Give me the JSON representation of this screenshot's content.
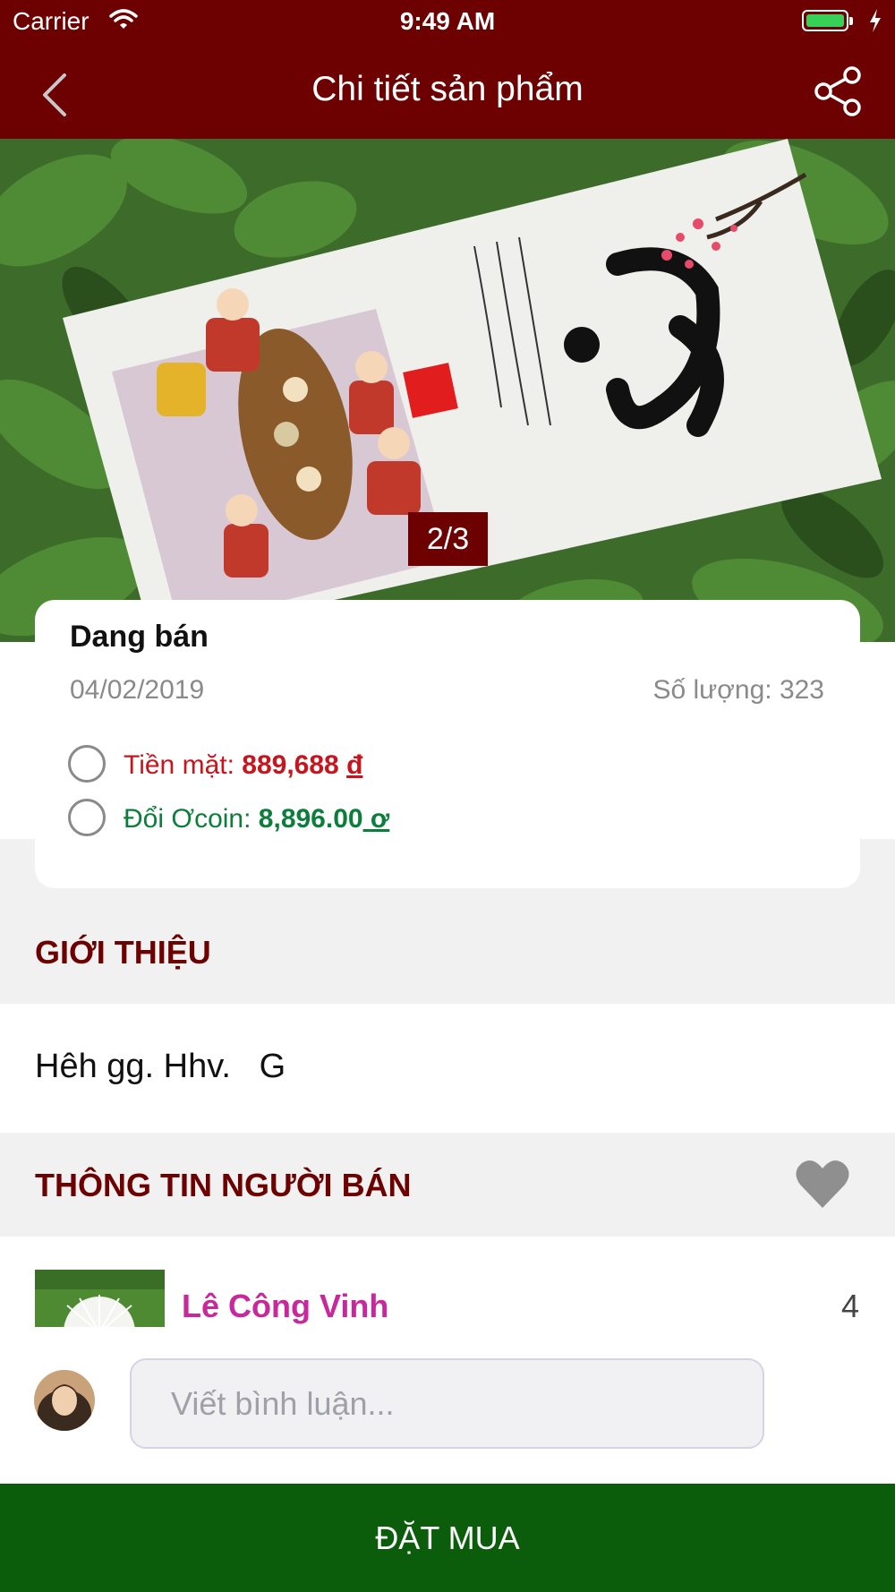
{
  "status_bar": {
    "carrier": "Carrier",
    "time": "9:49 AM"
  },
  "nav": {
    "title": "Chi tiết sản phẩm"
  },
  "gallery": {
    "counter": "2/3"
  },
  "product": {
    "status": "Dang bán",
    "date": "04/02/2019",
    "quantity": "Số lượng: 323",
    "cash_label": "Tiền mặt:",
    "cash_value": "889,688",
    "cash_currency": "đ",
    "coin_label": "Đổi Ơcoin:",
    "coin_value": "8,896.00",
    "coin_currency": "ơ"
  },
  "intro": {
    "heading": "GIỚI THIỆU",
    "text": "Hêh gg. Hhv.   G"
  },
  "seller": {
    "heading": "THÔNG TIN NGƯỜI BÁN",
    "name": "Lê Công Vinh",
    "count": "4"
  },
  "comment": {
    "placeholder": "Viết bình luận..."
  },
  "order_button": {
    "label": "ĐẶT MUA"
  },
  "colors": {
    "brand": "#6d0000",
    "cash": "#c8141c",
    "coin": "#0d7d3b",
    "seller_name": "#c8289b",
    "order": "#0b5c0b"
  },
  "icons": {
    "back": "chevron-left-icon",
    "share": "share-icon",
    "heart": "heart-icon",
    "wifi": "wifi-icon",
    "battery": "battery-icon"
  }
}
